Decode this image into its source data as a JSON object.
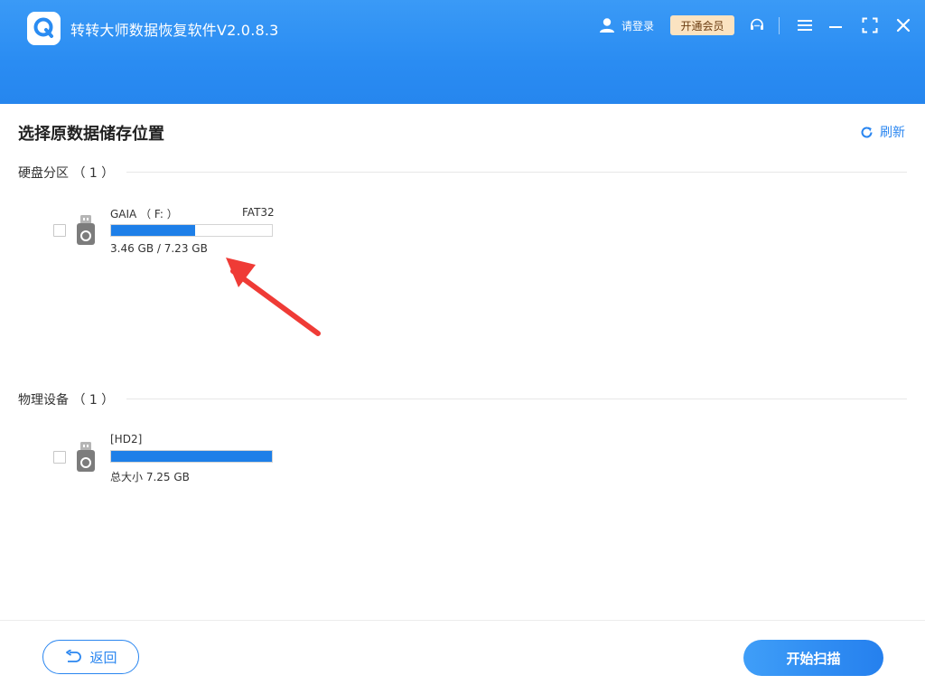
{
  "app": {
    "title": "转转大师数据恢复软件V2.0.8.3",
    "login_label": "请登录",
    "vip_label": "开通会员"
  },
  "icons": {
    "logo": "app-logo-icon",
    "user": "user-icon",
    "support": "headset-icon",
    "menu": "menu-icon",
    "minimize": "minimize-icon",
    "maximize": "maximize-icon",
    "close": "close-icon",
    "refresh": "refresh-icon",
    "drive": "usb-drive-icon",
    "back": "back-arrow-icon",
    "annotation": "red-arrow-annotation"
  },
  "colors": {
    "header": "#2a8cf2",
    "accent": "#2a86f0",
    "bar_fill": "#1e7fe8",
    "vip_bg": "#fbe3c1",
    "annotation": "#ef3b36"
  },
  "main": {
    "title": "选择原数据储存位置",
    "refresh_label": "刷新"
  },
  "sections": {
    "partitions": {
      "title": "硬盘分区 （ 1 ）",
      "items": [
        {
          "name": "GAIA （ F: ）",
          "filesystem": "FAT32",
          "size_text": "3.46 GB / 7.23 GB",
          "used_fraction": 0.52
        }
      ]
    },
    "physical": {
      "title": "物理设备 （ 1 ）",
      "items": [
        {
          "name": "[HD2]",
          "size_text": "总大小 7.25 GB",
          "used_fraction": 1.0
        }
      ]
    }
  },
  "footer": {
    "back_label": "返回",
    "scan_label": "开始扫描"
  }
}
